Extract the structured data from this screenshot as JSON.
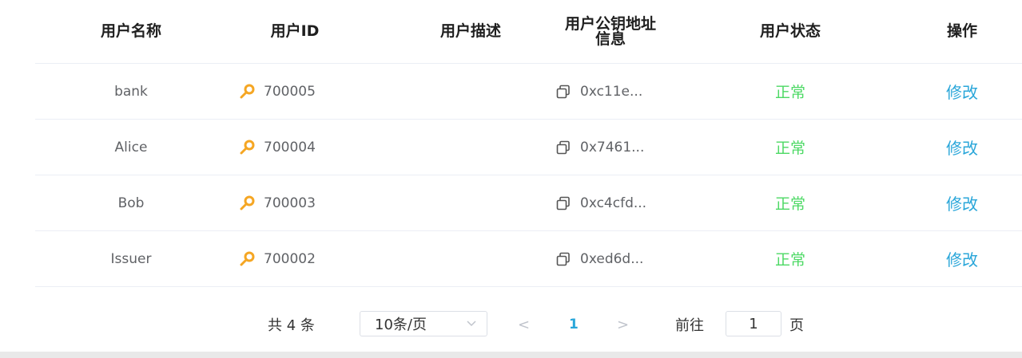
{
  "table": {
    "columns": [
      {
        "label": "用户名称"
      },
      {
        "label": "用户ID"
      },
      {
        "label": "用户描述"
      },
      {
        "label_line1": "用户公钥地址",
        "label_line2": "信息"
      },
      {
        "label": "用户状态"
      },
      {
        "label": "操作"
      }
    ],
    "rows": [
      {
        "name": "bank",
        "id": "700005",
        "description": "",
        "key": "0xc11e...",
        "status": "正常",
        "action": "修改"
      },
      {
        "name": "Alice",
        "id": "700004",
        "description": "",
        "key": "0x7461...",
        "status": "正常",
        "action": "修改"
      },
      {
        "name": "Bob",
        "id": "700003",
        "description": "",
        "key": "0xc4cfd...",
        "status": "正常",
        "action": "修改"
      },
      {
        "name": "Issuer",
        "id": "700002",
        "description": "",
        "key": "0xed6d...",
        "status": "正常",
        "action": "修改"
      }
    ]
  },
  "pagination": {
    "total": "共 4 条",
    "page_size": "10条/页",
    "prev": "<",
    "current": "1",
    "next": ">",
    "goto_label": "前往",
    "goto_value": "1",
    "page_label": "页"
  },
  "colors": {
    "status": "#4cd964",
    "action": "#29a6d9",
    "key_icon": "#f5a623"
  },
  "icons": {
    "key": "key-icon",
    "copy": "copy-icon",
    "dropdown": "chevron-down-icon"
  }
}
